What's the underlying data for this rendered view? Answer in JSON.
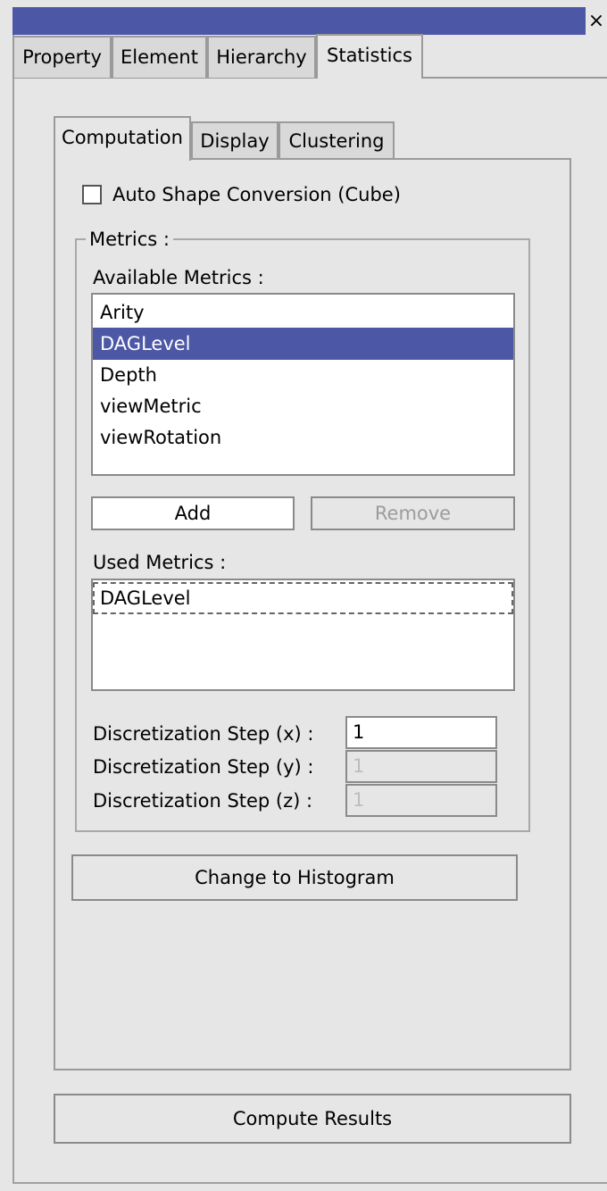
{
  "window": {
    "close_glyph": "×",
    "titlebar_color": "#4c57a6"
  },
  "main_tabs": [
    {
      "label": "Property",
      "active": false
    },
    {
      "label": "Element",
      "active": false
    },
    {
      "label": "Hierarchy",
      "active": false
    },
    {
      "label": "Statistics",
      "active": true
    }
  ],
  "sub_tabs": [
    {
      "label": "Computation",
      "active": true
    },
    {
      "label": "Display",
      "active": false
    },
    {
      "label": "Clustering",
      "active": false
    }
  ],
  "auto_shape": {
    "label": "Auto Shape Conversion (Cube)",
    "checked": false
  },
  "metrics": {
    "group_title": "Metrics :",
    "available_label": "Available Metrics :",
    "available": [
      "Arity",
      "DAGLevel",
      "Depth",
      "viewMetric",
      "viewRotation"
    ],
    "selected": "DAGLevel",
    "add_label": "Add",
    "remove_label": "Remove",
    "used_label": "Used Metrics :",
    "used": [
      "DAGLevel"
    ],
    "steps": [
      {
        "label": "Discretization Step (x) :",
        "value": "1",
        "enabled": true
      },
      {
        "label": "Discretization Step (y) :",
        "value": "1",
        "enabled": false
      },
      {
        "label": "Discretization Step (z) :",
        "value": "1",
        "enabled": false
      }
    ]
  },
  "histogram_button": "Change to Histogram",
  "compute_button": "Compute Results",
  "colors": {
    "accent": "#4c57a6",
    "background": "#e6e6e6",
    "disabled_text": "#9c9c9c"
  }
}
